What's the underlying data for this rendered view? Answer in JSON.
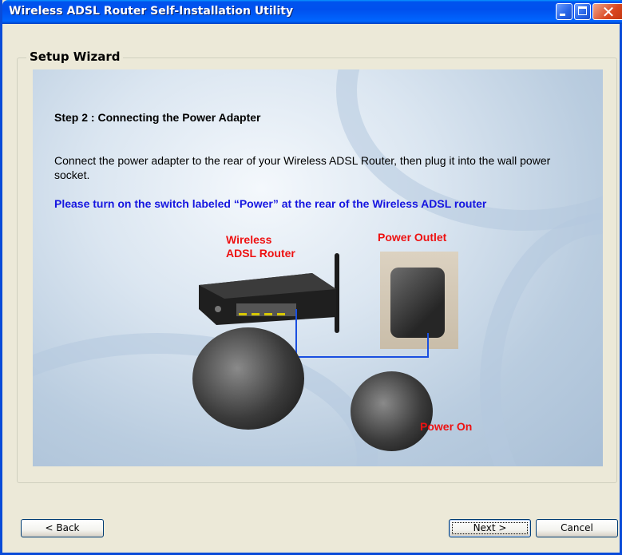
{
  "window": {
    "title": "Wireless ADSL Router Self-Installation Utility"
  },
  "wizard": {
    "group_title": "Setup Wizard",
    "step_title": "Step 2 : Connecting the Power Adapter",
    "description": "Connect the power adapter to the rear of your Wireless ADSL Router, then plug it into the wall power socket.",
    "note": "Please turn on the switch labeled “Power” at the rear of the Wireless ADSL router",
    "labels": {
      "router_line1": "Wireless",
      "router_line2": "ADSL Router",
      "outlet": "Power Outlet",
      "power_on": "Power On"
    }
  },
  "buttons": {
    "back": "< Back",
    "next": "Next >",
    "cancel": "Cancel"
  },
  "colors": {
    "title_bar": "#0053ee",
    "note_text": "#1515e0",
    "label_text": "#ee1111",
    "connector_line": "#1a4fe0"
  }
}
